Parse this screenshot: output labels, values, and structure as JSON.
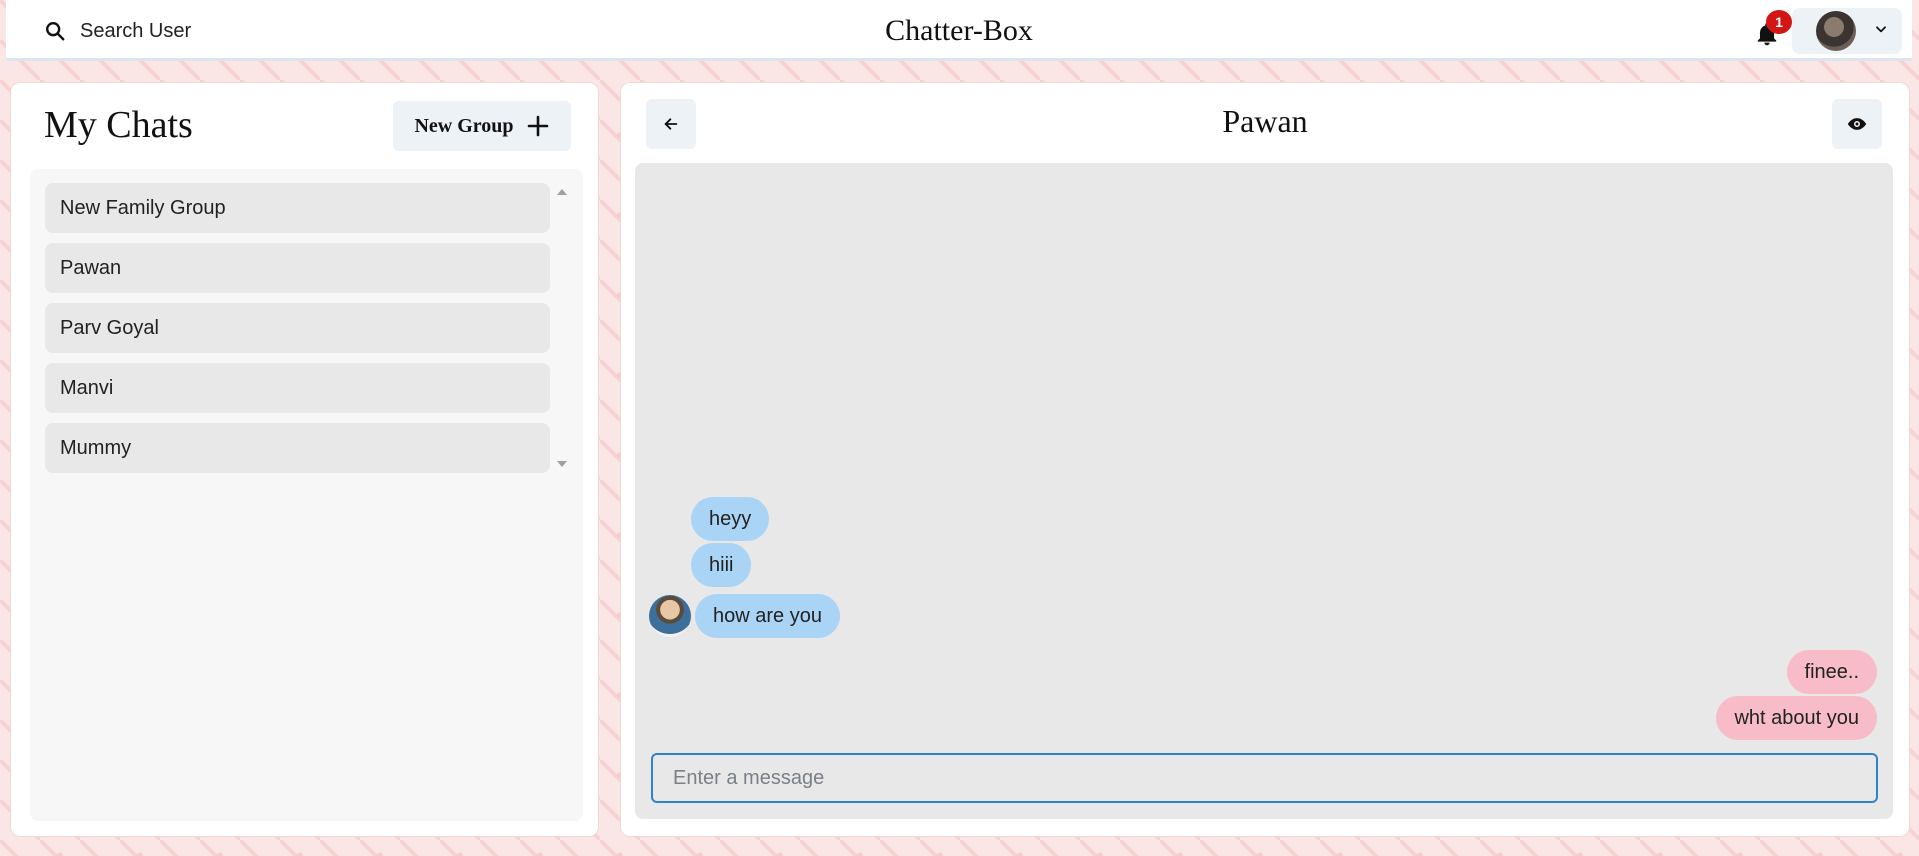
{
  "header": {
    "search_label": "Search User",
    "app_title": "Chatter-Box",
    "notification_count": "1",
    "icons": {
      "search": "search-icon",
      "bell": "bell-icon",
      "chevron": "chevron-down-icon"
    }
  },
  "sidebar": {
    "title": "My Chats",
    "new_group_label": "New Group",
    "chats": [
      {
        "name": "New Family Group"
      },
      {
        "name": "Pawan"
      },
      {
        "name": "Parv Goyal"
      },
      {
        "name": "Manvi"
      },
      {
        "name": "Mummy"
      }
    ]
  },
  "chat": {
    "name": "Pawan",
    "messages": [
      {
        "text": "heyy",
        "side": "received"
      },
      {
        "text": "hiii",
        "side": "received"
      },
      {
        "text": "how are you",
        "side": "received"
      },
      {
        "text": "finee..",
        "side": "sent"
      },
      {
        "text": "wht about you",
        "side": "sent"
      }
    ],
    "input_placeholder": "Enter a message"
  },
  "colors": {
    "received_bubble": "#a9d4f5",
    "sent_bubble": "#f7bcc8",
    "input_border": "#3182ce",
    "badge": "#d31515"
  }
}
